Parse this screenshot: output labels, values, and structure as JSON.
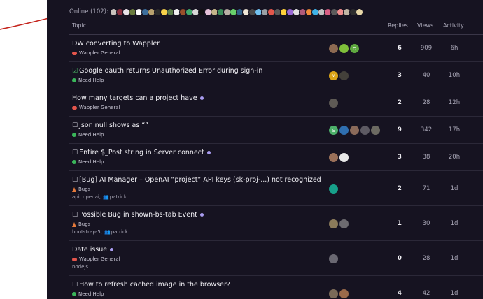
{
  "online_label": "Online (102):",
  "online_avatar_colors": [
    "#c9c3bd",
    "#8b2f3e",
    "#e8e2e8",
    "#6a7c3f",
    "#ffffff",
    "#3c6e9c",
    "#b9a26f",
    "#2c2c2c",
    "#f7d14a",
    "#5b7e4b",
    "#f0f0f0",
    "#9a4f2a",
    "#42a86b",
    "#d7d7d7",
    "#111111",
    "#e6c2d9",
    "#c4b58a",
    "#3a8d5a",
    "#bab0a6",
    "#68d06b",
    "#2f5f88",
    "#efe6d7",
    "#4a4a4a",
    "#73c2f1",
    "#9aa0a6",
    "#e2574c",
    "#5a5a5a",
    "#ffd23a",
    "#9a6ad6",
    "#e3e3e3",
    "#b05a7a",
    "#f28c3a",
    "#3fb2e6",
    "#c2c2c2",
    "#d95f84",
    "#5b5b5b",
    "#ef8e8e",
    "#c1b6a4",
    "#2e2e2e",
    "#e8d8a8"
  ],
  "table_headers": {
    "topic": "Topic",
    "replies": "Replies",
    "views": "Views",
    "activity": "Activity"
  },
  "topics": [
    {
      "checkbox": "",
      "title": "DW converting to Wappler",
      "unread": false,
      "category": "Wappler General",
      "category_icon": "chat-bubble-icon",
      "tags": "",
      "participants": "",
      "posters": [
        {
          "color": "#8d6a52",
          "letter": ""
        },
        {
          "color": "#7fbf3a",
          "letter": ""
        },
        {
          "color": "#5fa940",
          "letter": "D"
        }
      ],
      "replies": "6",
      "views": "909",
      "activity": "6h"
    },
    {
      "checkbox": "☑",
      "title": "Google oauth returns Unauthorized Error during sign-in",
      "unread": false,
      "category": "Need Help",
      "category_icon": "help-icon",
      "tags": "",
      "participants": "",
      "posters": [
        {
          "color": "#d9a318",
          "letter": "M"
        },
        {
          "color": "#43403a",
          "letter": ""
        }
      ],
      "replies": "3",
      "views": "40",
      "activity": "10h"
    },
    {
      "checkbox": "",
      "title": "How many targets can a project have",
      "unread": true,
      "category": "Wappler General",
      "category_icon": "chat-bubble-icon",
      "tags": "",
      "participants": "",
      "posters": [
        {
          "color": "#5e5a55",
          "letter": ""
        }
      ],
      "replies": "2",
      "views": "28",
      "activity": "12h"
    },
    {
      "checkbox": "☐",
      "title": "Json null shows as “”",
      "unread": false,
      "category": "Need Help",
      "category_icon": "help-icon",
      "tags": "",
      "participants": "",
      "posters": [
        {
          "color": "#4db06a",
          "letter": "S"
        },
        {
          "color": "#2f6fb0",
          "letter": ""
        },
        {
          "color": "#8a6a5a",
          "letter": ""
        },
        {
          "color": "#5d5a63",
          "letter": ""
        },
        {
          "color": "#6c6a62",
          "letter": ""
        }
      ],
      "replies": "9",
      "views": "342",
      "activity": "17h"
    },
    {
      "checkbox": "☐",
      "title": "Entire $_Post string in Server connect",
      "unread": true,
      "category": "Need Help",
      "category_icon": "help-icon",
      "tags": "",
      "participants": "",
      "posters": [
        {
          "color": "#9a7059",
          "letter": ""
        },
        {
          "color": "#e8e8e8",
          "letter": ""
        }
      ],
      "replies": "3",
      "views": "38",
      "activity": "20h"
    },
    {
      "checkbox": "☐",
      "title": "[Bug] AI Manager – OpenAI “project” API keys (sk-proj-...) not recognized",
      "unread": false,
      "category": "Bugs",
      "category_icon": "bug-icon",
      "tags": "api, openai,",
      "participants": "patrick",
      "posters": [
        {
          "color": "#17a08a",
          "letter": ""
        }
      ],
      "replies": "2",
      "views": "71",
      "activity": "1d"
    },
    {
      "checkbox": "☐",
      "title": "Possible Bug in shown-bs-tab Event",
      "unread": true,
      "category": "Bugs",
      "category_icon": "bug-icon",
      "tags": "bootstrap-5,",
      "participants": "patrick",
      "posters": [
        {
          "color": "#8a7a5a",
          "letter": ""
        },
        {
          "color": "#6d6b70",
          "letter": ""
        }
      ],
      "replies": "1",
      "views": "30",
      "activity": "1d"
    },
    {
      "checkbox": "",
      "title": "Date issue",
      "unread": true,
      "category": "Wappler General",
      "category_icon": "chat-bubble-icon",
      "tags": "nodejs",
      "participants": "",
      "posters": [
        {
          "color": "#6a6872",
          "letter": ""
        }
      ],
      "replies": "0",
      "views": "28",
      "activity": "1d"
    },
    {
      "checkbox": "☐",
      "title": "How to refresh cached image in the browser?",
      "unread": false,
      "category": "Need Help",
      "category_icon": "help-icon",
      "tags": "",
      "participants": "",
      "posters": [
        {
          "color": "#7a6a58",
          "letter": ""
        },
        {
          "color": "#9a6a4a",
          "letter": ""
        }
      ],
      "replies": "4",
      "views": "42",
      "activity": "1d"
    }
  ]
}
